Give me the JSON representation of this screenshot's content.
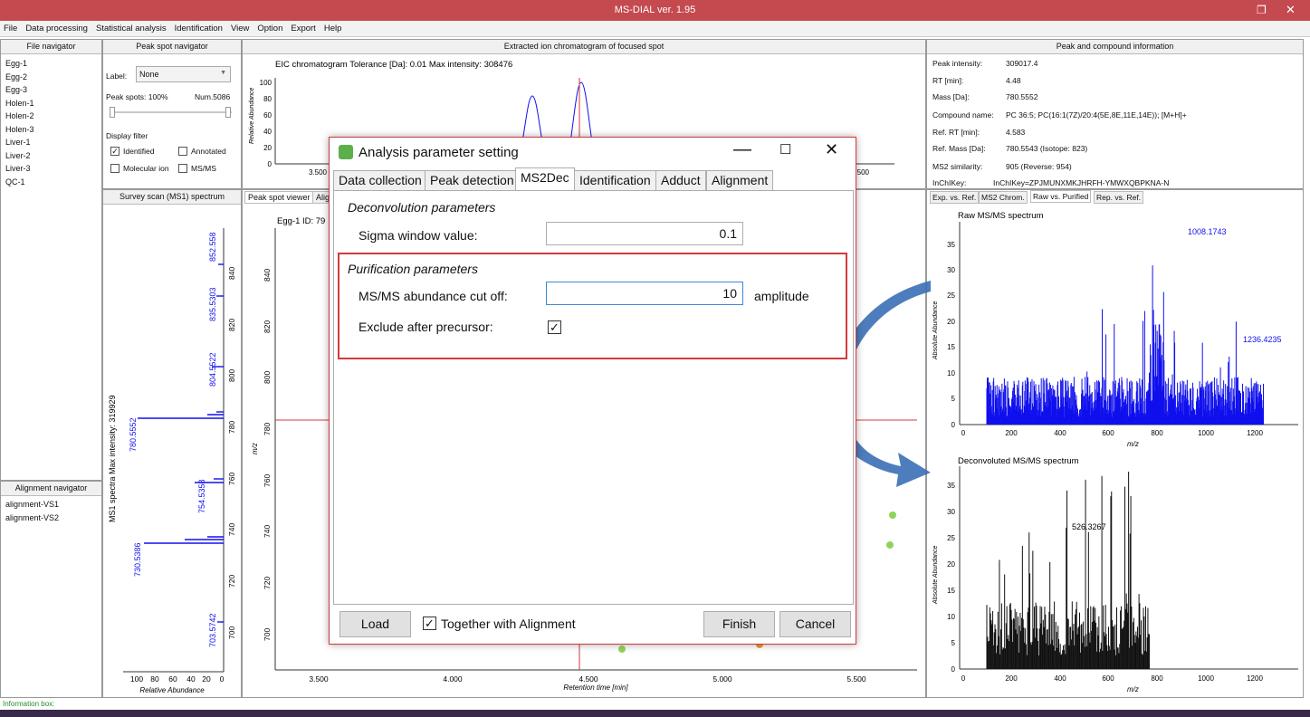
{
  "window": {
    "title": "MS-DIAL ver. 1.95"
  },
  "menu": [
    "File",
    "Data processing",
    "Statistical analysis",
    "Identification",
    "View",
    "Option",
    "Export",
    "Help"
  ],
  "file_navigator": {
    "header": "File navigator",
    "files": [
      "Egg-1",
      "Egg-2",
      "Egg-3",
      "Holen-1",
      "Holen-2",
      "Holen-3",
      "Liver-1",
      "Liver-2",
      "Liver-3",
      "QC-1"
    ]
  },
  "peak_spot_navigator": {
    "header": "Peak spot navigator",
    "label_caption": "Label:",
    "label_value": "None",
    "peak_spots": "Peak spots: 100%",
    "num": "Num.5086",
    "display_filter": "Display filter",
    "identified": "Identified",
    "annotated": "Annotated",
    "molecular_ion": "Molecular ion",
    "msms": "MS/MS"
  },
  "alignment_navigator": {
    "header": "Alignment navigator",
    "items": [
      "alignment-VS1",
      "alignment-VS2"
    ]
  },
  "survey_scan": {
    "header": "Survey scan (MS1) spectrum",
    "ylabel": "MS1 spectra Max intensity: 319929",
    "xlabel": "Relative Abundance",
    "xticks": [
      "100",
      "80",
      "60",
      "40",
      "20",
      "0"
    ],
    "mz_ticks": [
      "840",
      "820",
      "800",
      "780",
      "760",
      "740",
      "720",
      "700"
    ],
    "peak_labels": [
      "852.558",
      "835.5303",
      "804.5522",
      "780.5552",
      "754.5358",
      "730.5386",
      "703.5742"
    ]
  },
  "eic": {
    "header": "Extracted ion chromatogram of focused spot",
    "title": "EIC chromatogram Tolerance [Da]: 0.01  Max intensity: 308476",
    "ylabel": "Relative Abundance",
    "yticks": [
      "100",
      "80",
      "60",
      "40",
      "20",
      "0"
    ],
    "xticks": [
      "3.500",
      "5.500"
    ]
  },
  "peak_viewer": {
    "tabs": [
      "Peak spot viewer",
      "Alig"
    ],
    "title": "Egg-1  ID: 79",
    "ylabel": "m/z",
    "xlabel": "Retention time [min]",
    "yticks": [
      "840",
      "820",
      "800",
      "780",
      "760",
      "740",
      "720",
      "700"
    ],
    "xticks": [
      "3.500",
      "4.000",
      "4.500",
      "5.000",
      "5.500"
    ]
  },
  "compound_info": {
    "header": "Peak and compound information",
    "rows": [
      [
        "Peak intensity:",
        "309017.4"
      ],
      [
        "RT [min]:",
        "4.48"
      ],
      [
        "Mass [Da]:",
        "780.5552"
      ],
      [
        "Compound name:",
        "PC 36:5; PC(16:1(7Z)/20:4(5E,8E,11E,14E)); [M+H]+"
      ],
      [
        "Ref. RT [min]:",
        "4.583"
      ],
      [
        "Ref. Mass [Da]:",
        "780.5543 (Isotope: 823)"
      ],
      [
        "MS2 similarity:",
        "905 (Reverse: 954)"
      ],
      [
        "InChIKey:",
        "InChIKey=ZPJMUNXMKJHRFH-YMWXQBPKNA-N"
      ]
    ]
  },
  "spectrum_tabs": [
    "Exp. vs. Ref.",
    "MS2 Chrom.",
    "Raw vs. Purified",
    "Rep. vs. Ref."
  ],
  "raw_spectrum": {
    "title": "Raw MS/MS spectrum",
    "ylabel": "Absolute Abundance",
    "xlabel": "m/z",
    "yticks": [
      "35",
      "30",
      "25",
      "20",
      "15",
      "10",
      "5",
      "0"
    ],
    "xticks": [
      "0",
      "200",
      "400",
      "600",
      "800",
      "1000",
      "1200"
    ],
    "labels": [
      "1008.1743",
      "1236.4235"
    ]
  },
  "deconv_spectrum": {
    "title": "Deconvoluted MS/MS spectrum",
    "ylabel": "Absolute Abundance",
    "xlabel": "m/z",
    "yticks": [
      "35",
      "30",
      "25",
      "20",
      "15",
      "10",
      "5",
      "0"
    ],
    "xticks": [
      "0",
      "200",
      "400",
      "600",
      "800",
      "1000",
      "1200"
    ],
    "labels": [
      "526.3267"
    ]
  },
  "info_box": "Information box:",
  "dialog": {
    "title": "Analysis parameter setting",
    "tabs": [
      "Data collection",
      "Peak detection",
      "MS2Dec",
      "Identification",
      "Adduct",
      "Alignment"
    ],
    "deconv_header": "Deconvolution parameters",
    "sigma_label": "Sigma window value:",
    "sigma_value": "0.1",
    "purif_header": "Purification parameters",
    "cutoff_label": "MS/MS abundance cut off:",
    "cutoff_value": "10",
    "cutoff_unit": "amplitude",
    "exclude_label": "Exclude after precursor:",
    "load": "Load",
    "together": "Together with Alignment",
    "finish": "Finish",
    "cancel": "Cancel"
  },
  "colors": {
    "titlebar": "#c44a4f",
    "spectrum_blue": "#1010ee",
    "highlight_red": "#d23a3a",
    "arrow_blue": "#3a6fb5"
  }
}
